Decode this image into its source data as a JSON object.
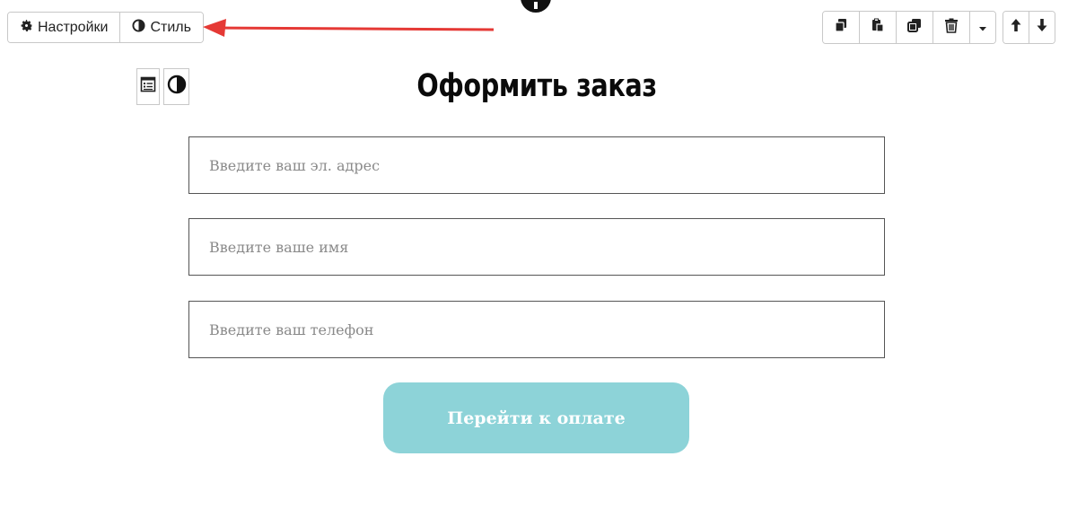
{
  "toolbar": {
    "settings_label": "Настройки",
    "style_label": "Стиль",
    "icons": [
      "gear-icon",
      "contrast-icon",
      "copy-icon",
      "paste-icon",
      "duplicate-icon",
      "trash-icon",
      "caret-down-icon",
      "arrow-up-icon",
      "arrow-down-icon"
    ]
  },
  "form": {
    "title": "Оформить заказ",
    "email_placeholder": "Введите ваш эл. адрес",
    "name_placeholder": "Введите ваше имя",
    "phone_placeholder": "Введите ваш телефон",
    "submit_label": "Перейти к оплате"
  },
  "colors": {
    "annotation_arrow": "#e53935",
    "submit_button": "#8dd3d8",
    "title": "#0a0a0a"
  }
}
